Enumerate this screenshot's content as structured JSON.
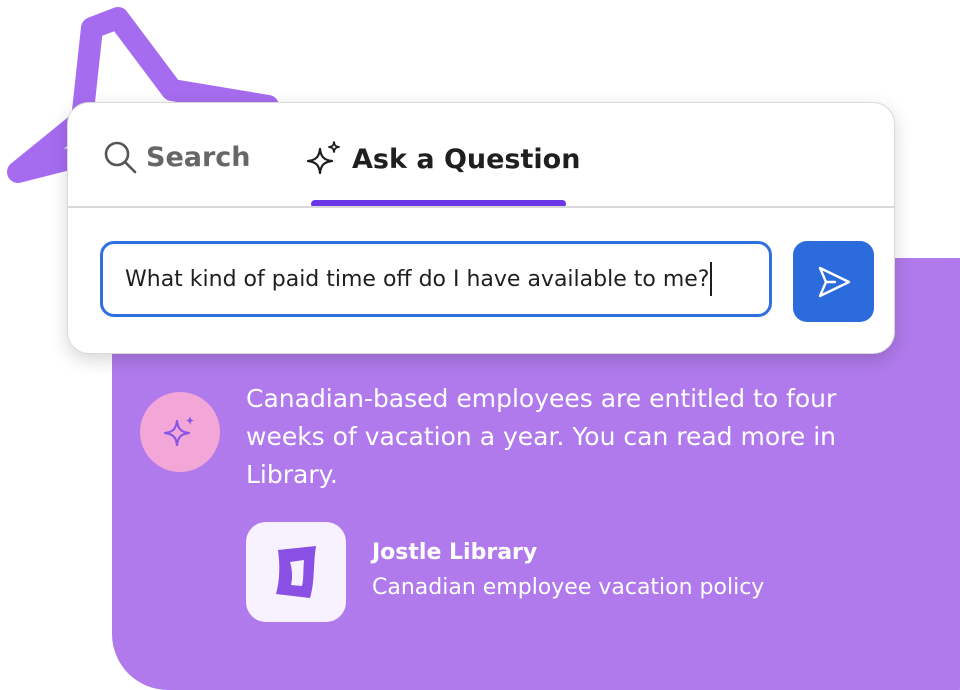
{
  "tabs": {
    "search_label": "Search",
    "ask_label": "Ask a Question",
    "active": "ask"
  },
  "question_input": {
    "value": "What kind of paid time off do I have available to me?"
  },
  "answer": {
    "text": "Canadian-based employees are entitled to four weeks of vacation a year. You can read more in Library."
  },
  "library_result": {
    "title": "Jostle Library",
    "subtitle": "Canadian employee vacation policy"
  },
  "colors": {
    "accent_purple": "#6c37e6",
    "panel_purple": "#b07aec",
    "input_blue": "#2f6fde",
    "send_blue": "#2c6bdb",
    "avatar_pink": "#f3a6d8"
  },
  "icons": {
    "search": "search-icon",
    "ask": "sparkle-icon",
    "send": "send-icon",
    "avatar": "sparkle-icon",
    "library": "jostle-library-logo"
  }
}
